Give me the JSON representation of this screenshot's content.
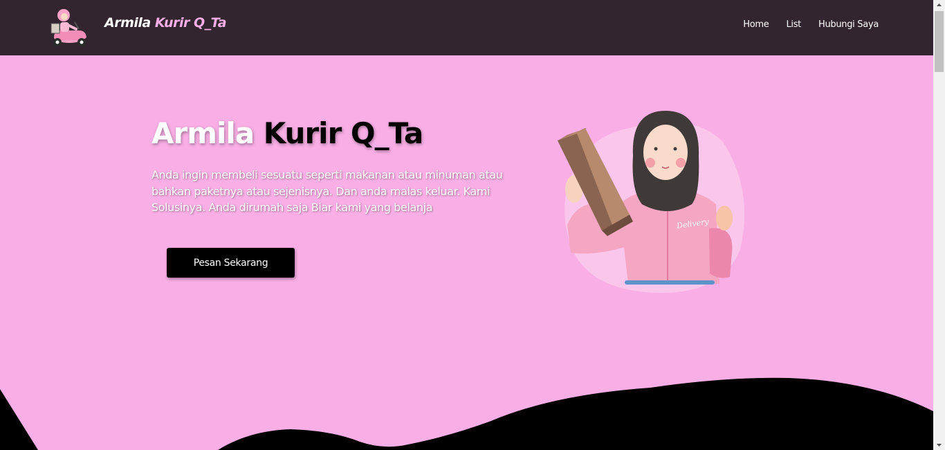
{
  "navbar": {
    "brand_first": "Armila",
    "brand_second": "Kurir Q_Ta",
    "links": [
      "Home",
      "List",
      "Hubungi Saya"
    ]
  },
  "hero": {
    "title_first": "Armila",
    "title_second": "Kurir Q_Ta",
    "description": "Anda ingin membeli sesuatu seperti makanan atau minuman atau bahkan paketnya atau sejenisnya. Dan anda malas keluar. Kami Solusinya. Anda dirumah saja Biar kami yang belanja",
    "cta_label": "Pesan Sekarang",
    "illustration_text": "Delivery"
  },
  "colors": {
    "navbar_bg": "#32252f",
    "page_bg": "#f9aee5",
    "accent_pink": "#f9aee5",
    "button_bg": "#000000",
    "wave": "#000000"
  },
  "icons": {
    "brand_logo": "scooter-courier-icon",
    "hero_image": "courier-holding-package-illustration"
  }
}
